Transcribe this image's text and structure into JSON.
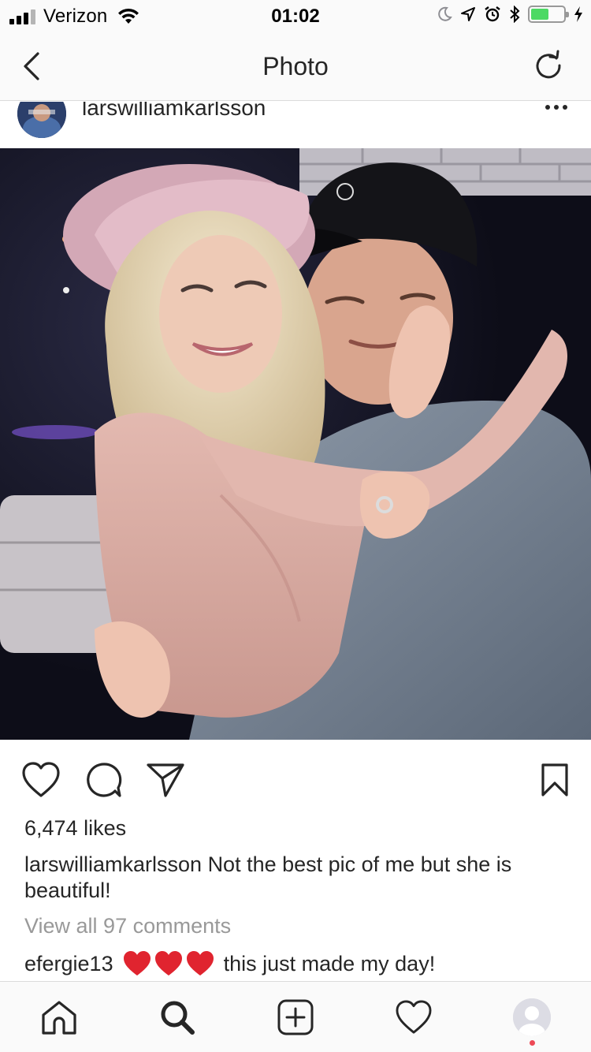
{
  "status_bar": {
    "carrier": "Verizon",
    "time": "01:02",
    "battery_level": 0.55,
    "signal_bars_filled": 3,
    "signal_bars_total": 4
  },
  "nav": {
    "title": "Photo",
    "back_icon": "chevron-left-icon",
    "refresh_icon": "refresh-icon"
  },
  "post": {
    "username": "larswilliamkarlsson",
    "likes_text": "6,474 likes",
    "caption_user": "larswilliamkarlsson",
    "caption_text": "Not the best pic of me but she is beautiful!",
    "view_comments": "View all 97 comments",
    "comment": {
      "user": "efergie13",
      "emoji": "❤️❤️❤️",
      "text": "this just made my day!"
    }
  },
  "tab_bar": {
    "items": [
      {
        "name": "home",
        "icon": "home-icon"
      },
      {
        "name": "search",
        "icon": "search-icon"
      },
      {
        "name": "add",
        "icon": "add-icon"
      },
      {
        "name": "activity",
        "icon": "heart-icon"
      },
      {
        "name": "profile",
        "icon": "avatar"
      }
    ]
  },
  "colors": {
    "text": "#262626",
    "muted": "#999999",
    "bar_bg": "#fafafa",
    "divider": "#dbdbdb",
    "battery": "#4cd964",
    "notification_dot": "#ed4956",
    "heart_red": "#e0242f"
  }
}
